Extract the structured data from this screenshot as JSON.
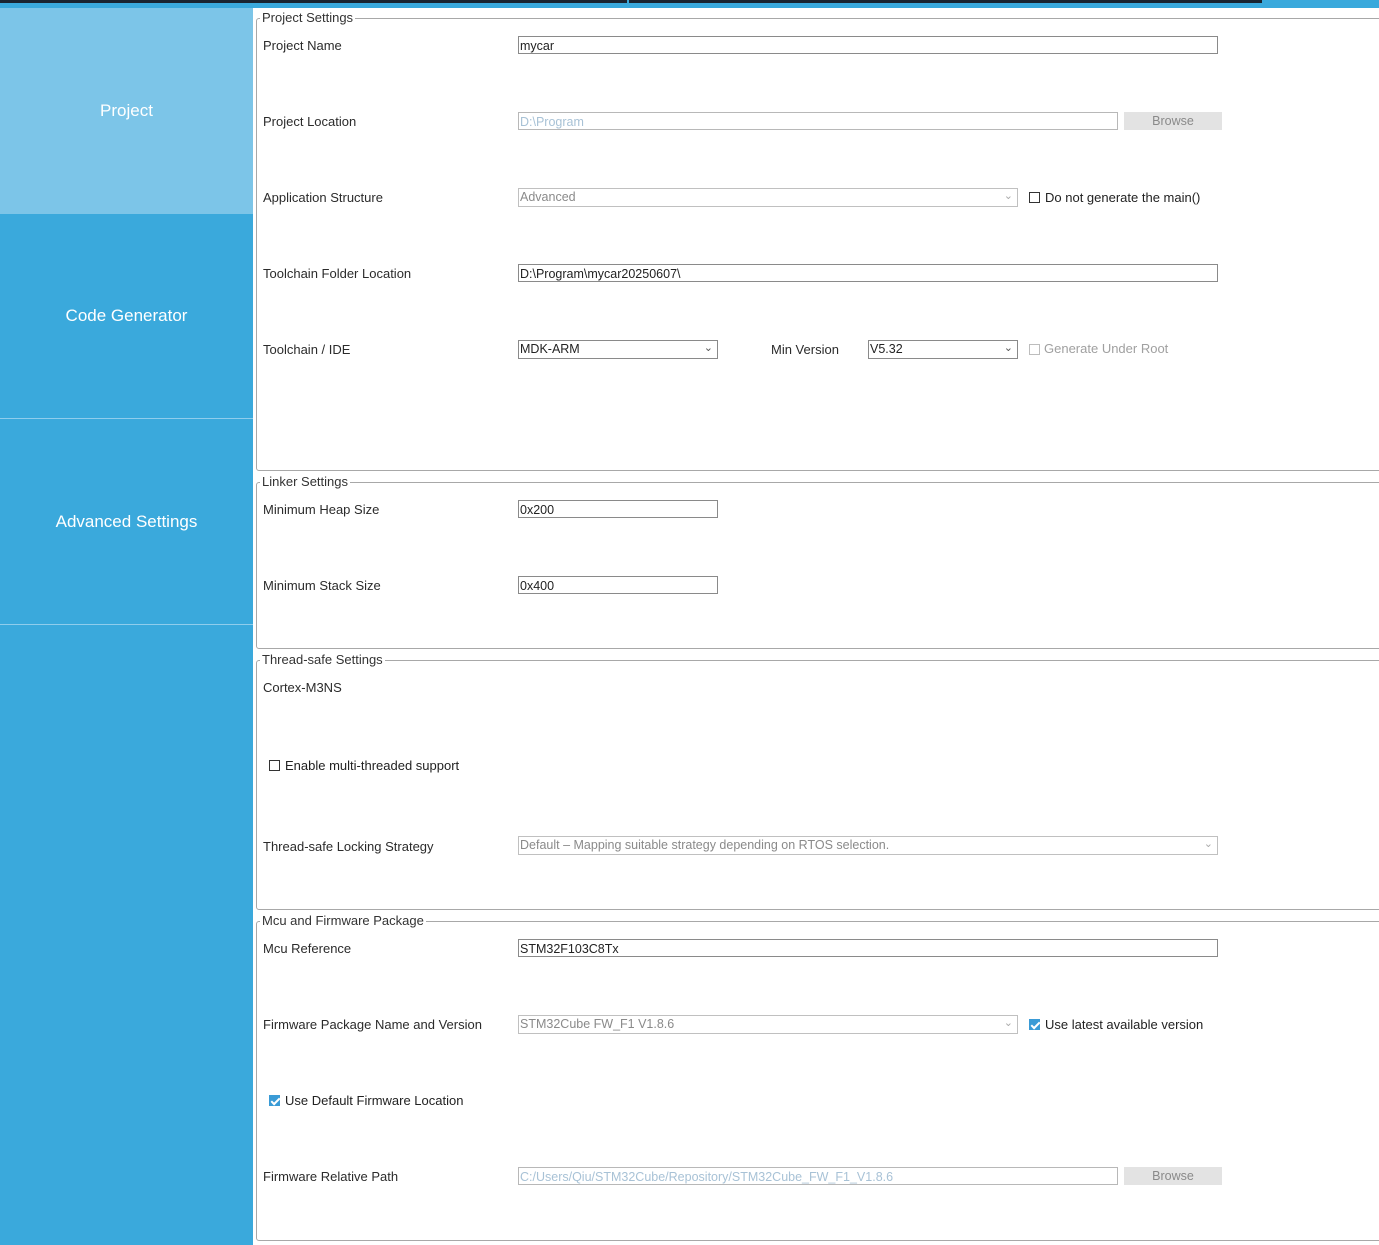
{
  "sidebar": {
    "items": [
      {
        "label": "Project",
        "active": true
      },
      {
        "label": "Code Generator",
        "active": false
      },
      {
        "label": "Advanced Settings",
        "active": false
      }
    ]
  },
  "project_settings": {
    "legend": "Project Settings",
    "project_name": {
      "label": "Project Name",
      "value": "mycar"
    },
    "project_location": {
      "label": "Project Location",
      "value": "D:\\Program",
      "button": "Browse"
    },
    "application_structure": {
      "label": "Application Structure",
      "value": "Advanced",
      "checkbox": {
        "label": "Do not generate the main()",
        "checked": false
      }
    },
    "toolchain_folder": {
      "label": "Toolchain Folder Location",
      "value": "D:\\Program\\mycar20250607\\"
    },
    "toolchain_ide": {
      "label": "Toolchain / IDE",
      "value": "MDK-ARM",
      "min_version_label": "Min Version",
      "min_version_value": "V5.32",
      "checkbox": {
        "label": "Generate Under Root",
        "checked": false,
        "disabled": true
      }
    }
  },
  "linker_settings": {
    "legend": "Linker Settings",
    "heap": {
      "label": "Minimum Heap Size",
      "value": "0x200"
    },
    "stack": {
      "label": "Minimum Stack Size",
      "value": "0x400"
    }
  },
  "thread_safe": {
    "legend": "Thread-safe Settings",
    "core": "Cortex-M3NS",
    "multithread": {
      "label": "Enable multi-threaded support",
      "checked": false
    },
    "locking": {
      "label": "Thread-safe Locking Strategy",
      "value": "Default  –  Mapping suitable strategy depending on RTOS selection."
    }
  },
  "mcu_firmware": {
    "legend": "Mcu and Firmware Package",
    "mcu_reference": {
      "label": "Mcu Reference",
      "value": "STM32F103C8Tx"
    },
    "firmware_package": {
      "label": "Firmware Package Name and Version",
      "value": "STM32Cube FW_F1 V1.8.6",
      "checkbox": {
        "label": "Use latest available version",
        "checked": true
      }
    },
    "default_location": {
      "label": "Use Default Firmware Location",
      "checked": true
    },
    "relative_path": {
      "label": "Firmware Relative Path",
      "value": "C:/Users/Qiu/STM32Cube/Repository/STM32Cube_FW_F1_V1.8.6",
      "button": "Browse"
    }
  },
  "icons": {
    "dropdown": "chevron-down-icon",
    "checkbox": "checkbox-icon"
  },
  "colors": {
    "sidebar": "#3aa9dc",
    "sidebar_active": "#7cc5e8",
    "checkbox_checked": "#3a9bd6"
  }
}
